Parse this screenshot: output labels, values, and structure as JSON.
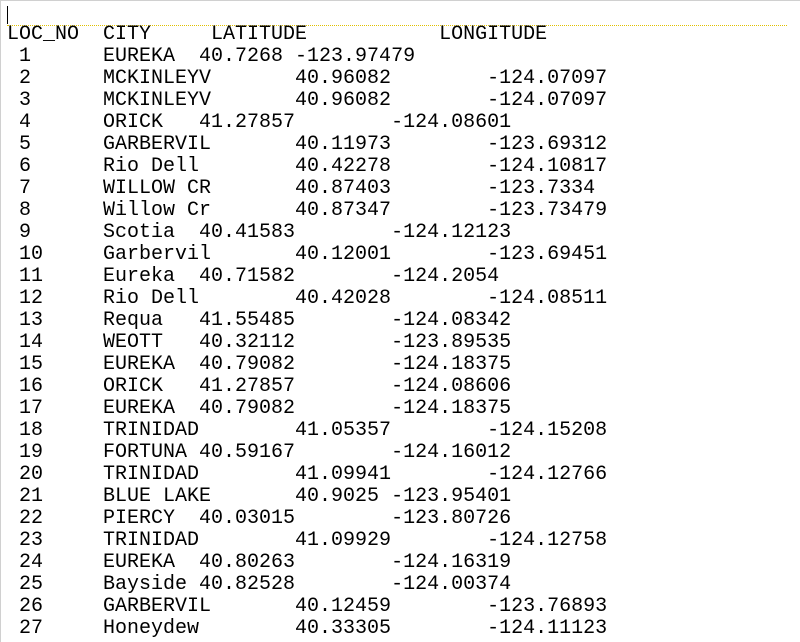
{
  "headers": {
    "loc_no": "LOC_NO",
    "city": "CITY",
    "latitude": "LATITUDE",
    "longitude": "LONGITUDE"
  },
  "header_positions": {
    "loc_no": 0,
    "city": 8,
    "latitude": 17,
    "longitude": 36
  },
  "col_positions": {
    "loc_no": 1,
    "city": 8,
    "latitude": 17,
    "longitude": 27
  },
  "lat_width": 8,
  "rows": [
    {
      "loc_no": "1",
      "city": "EUREKA",
      "latitude": "40.7268",
      "longitude": "-123.97479"
    },
    {
      "loc_no": "2",
      "city": "MCKINLEYV",
      "latitude": "40.96082",
      "longitude": "-124.07097"
    },
    {
      "loc_no": "3",
      "city": "MCKINLEYV",
      "latitude": "40.96082",
      "longitude": "-124.07097"
    },
    {
      "loc_no": "4",
      "city": "ORICK",
      "latitude": "41.27857",
      "longitude": "-124.08601"
    },
    {
      "loc_no": "5",
      "city": "GARBERVIL",
      "latitude": "40.11973",
      "longitude": "-123.69312"
    },
    {
      "loc_no": "6",
      "city": "Rio Dell",
      "latitude": "40.42278",
      "longitude": "-124.10817"
    },
    {
      "loc_no": "7",
      "city": "WILLOW CR",
      "latitude": "40.87403",
      "longitude": "-123.7334"
    },
    {
      "loc_no": "8",
      "city": "Willow Cr",
      "latitude": "40.87347",
      "longitude": "-123.73479"
    },
    {
      "loc_no": "9",
      "city": "Scotia",
      "latitude": "40.41583",
      "longitude": "-124.12123"
    },
    {
      "loc_no": "10",
      "city": "Garbervil",
      "latitude": "40.12001",
      "longitude": "-123.69451"
    },
    {
      "loc_no": "11",
      "city": "Eureka",
      "latitude": "40.71582",
      "longitude": "-124.2054"
    },
    {
      "loc_no": "12",
      "city": "Rio Dell",
      "latitude": "40.42028",
      "longitude": "-124.08511"
    },
    {
      "loc_no": "13",
      "city": "Requa",
      "latitude": "41.55485",
      "longitude": "-124.08342"
    },
    {
      "loc_no": "14",
      "city": "WEOTT",
      "latitude": "40.32112",
      "longitude": "-123.89535"
    },
    {
      "loc_no": "15",
      "city": "EUREKA",
      "latitude": "40.79082",
      "longitude": "-124.18375"
    },
    {
      "loc_no": "16",
      "city": "ORICK",
      "latitude": "41.27857",
      "longitude": "-124.08606"
    },
    {
      "loc_no": "17",
      "city": "EUREKA",
      "latitude": "40.79082",
      "longitude": "-124.18375"
    },
    {
      "loc_no": "18",
      "city": "TRINIDAD",
      "latitude": "41.05357",
      "longitude": "-124.15208"
    },
    {
      "loc_no": "19",
      "city": "FORTUNA",
      "latitude": "40.59167",
      "longitude": "-124.16012"
    },
    {
      "loc_no": "20",
      "city": "TRINIDAD",
      "latitude": "41.09941",
      "longitude": "-124.12766"
    },
    {
      "loc_no": "21",
      "city": "BLUE LAKE",
      "latitude": "40.9025",
      "longitude": "-123.95401"
    },
    {
      "loc_no": "22",
      "city": "PIERCY",
      "latitude": "40.03015",
      "longitude": "-123.80726"
    },
    {
      "loc_no": "23",
      "city": "TRINIDAD",
      "latitude": "41.09929",
      "longitude": "-124.12758"
    },
    {
      "loc_no": "24",
      "city": "EUREKA",
      "latitude": "40.80263",
      "longitude": "-124.16319"
    },
    {
      "loc_no": "25",
      "city": "Bayside",
      "latitude": "40.82528",
      "longitude": "-124.00374"
    },
    {
      "loc_no": "26",
      "city": "GARBERVIL",
      "latitude": "40.12459",
      "longitude": "-123.76893"
    },
    {
      "loc_no": "27",
      "city": "Honeydew",
      "latitude": "40.33305",
      "longitude": "-124.11123"
    }
  ]
}
